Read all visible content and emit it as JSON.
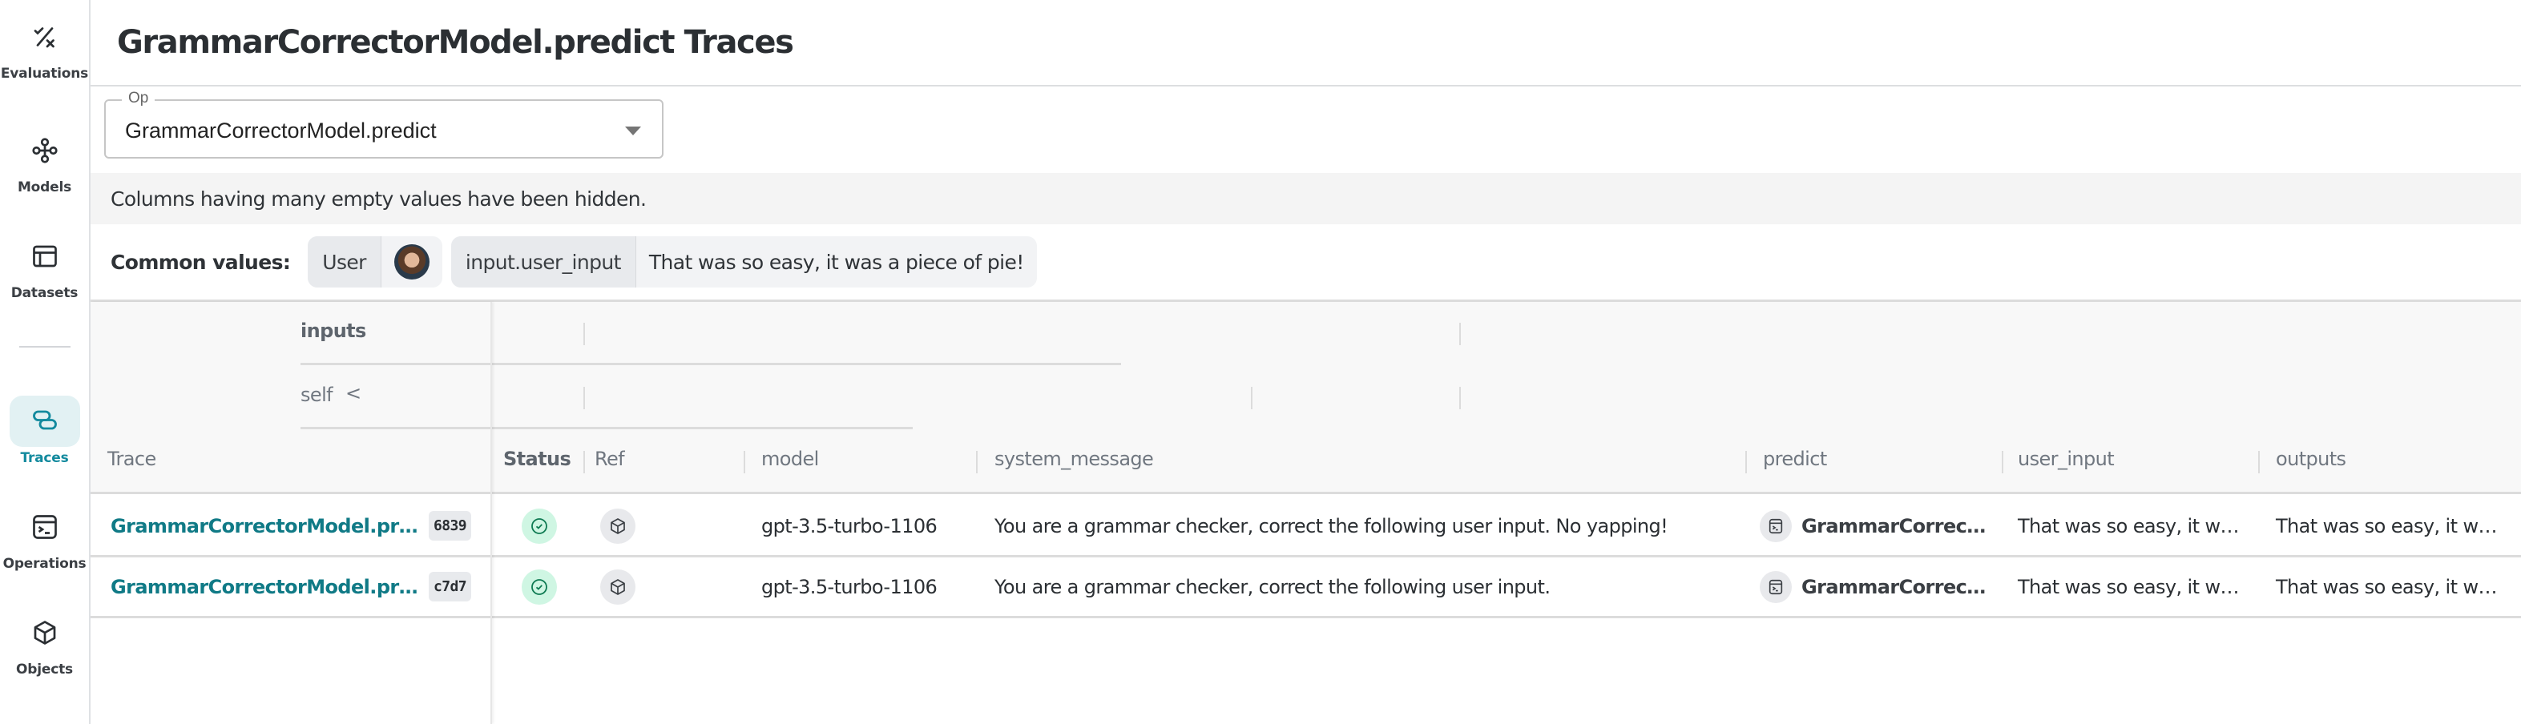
{
  "sidebar": {
    "items": [
      {
        "label": "Evaluations",
        "icon": "evaluations-icon",
        "active": false
      },
      {
        "label": "Models",
        "icon": "models-icon",
        "active": false
      },
      {
        "label": "Datasets",
        "icon": "datasets-icon",
        "active": false
      },
      {
        "label": "Traces",
        "icon": "traces-icon",
        "active": true
      },
      {
        "label": "Operations",
        "icon": "operations-icon",
        "active": false
      },
      {
        "label": "Objects",
        "icon": "objects-icon",
        "active": false
      }
    ],
    "accent_color": "#138a9e"
  },
  "header": {
    "title": "GrammarCorrectorModel.predict Traces"
  },
  "op_filter": {
    "label": "Op",
    "value": "GrammarCorrectorModel.predict"
  },
  "banner": {
    "text": "Columns having many empty values have been hidden."
  },
  "common_values": {
    "label": "Common values:",
    "chips": [
      {
        "key": "User",
        "value_type": "avatar"
      },
      {
        "key": "input.user_input",
        "value": "That was so easy, it was a piece of pie!"
      }
    ]
  },
  "table": {
    "group_headers": {
      "inputs": "inputs",
      "self": "self",
      "self_toggle": "<"
    },
    "columns": {
      "trace": "Trace",
      "status": "Status",
      "ref": "Ref",
      "model": "model",
      "system_message": "system_message",
      "predict": "predict",
      "user_input": "user_input",
      "outputs": "outputs"
    },
    "rows": [
      {
        "trace": "GrammarCorrectorModel.pr…",
        "id": "6839",
        "status": "success",
        "model": "gpt-3.5-turbo-1106",
        "system_message": "You are a grammar checker, correct the following user input. No yapping!",
        "predict": "GrammarCorrec…",
        "user_input": "That was so easy, it w…",
        "outputs": "That was so easy, it w…"
      },
      {
        "trace": "GrammarCorrectorModel.pr…",
        "id": "c7d7",
        "status": "success",
        "model": "gpt-3.5-turbo-1106",
        "system_message": "You are a grammar checker, correct the following user input.",
        "predict": "GrammarCorrec…",
        "user_input": "That was so easy, it w…",
        "outputs": "That was so easy, it w…"
      }
    ]
  }
}
